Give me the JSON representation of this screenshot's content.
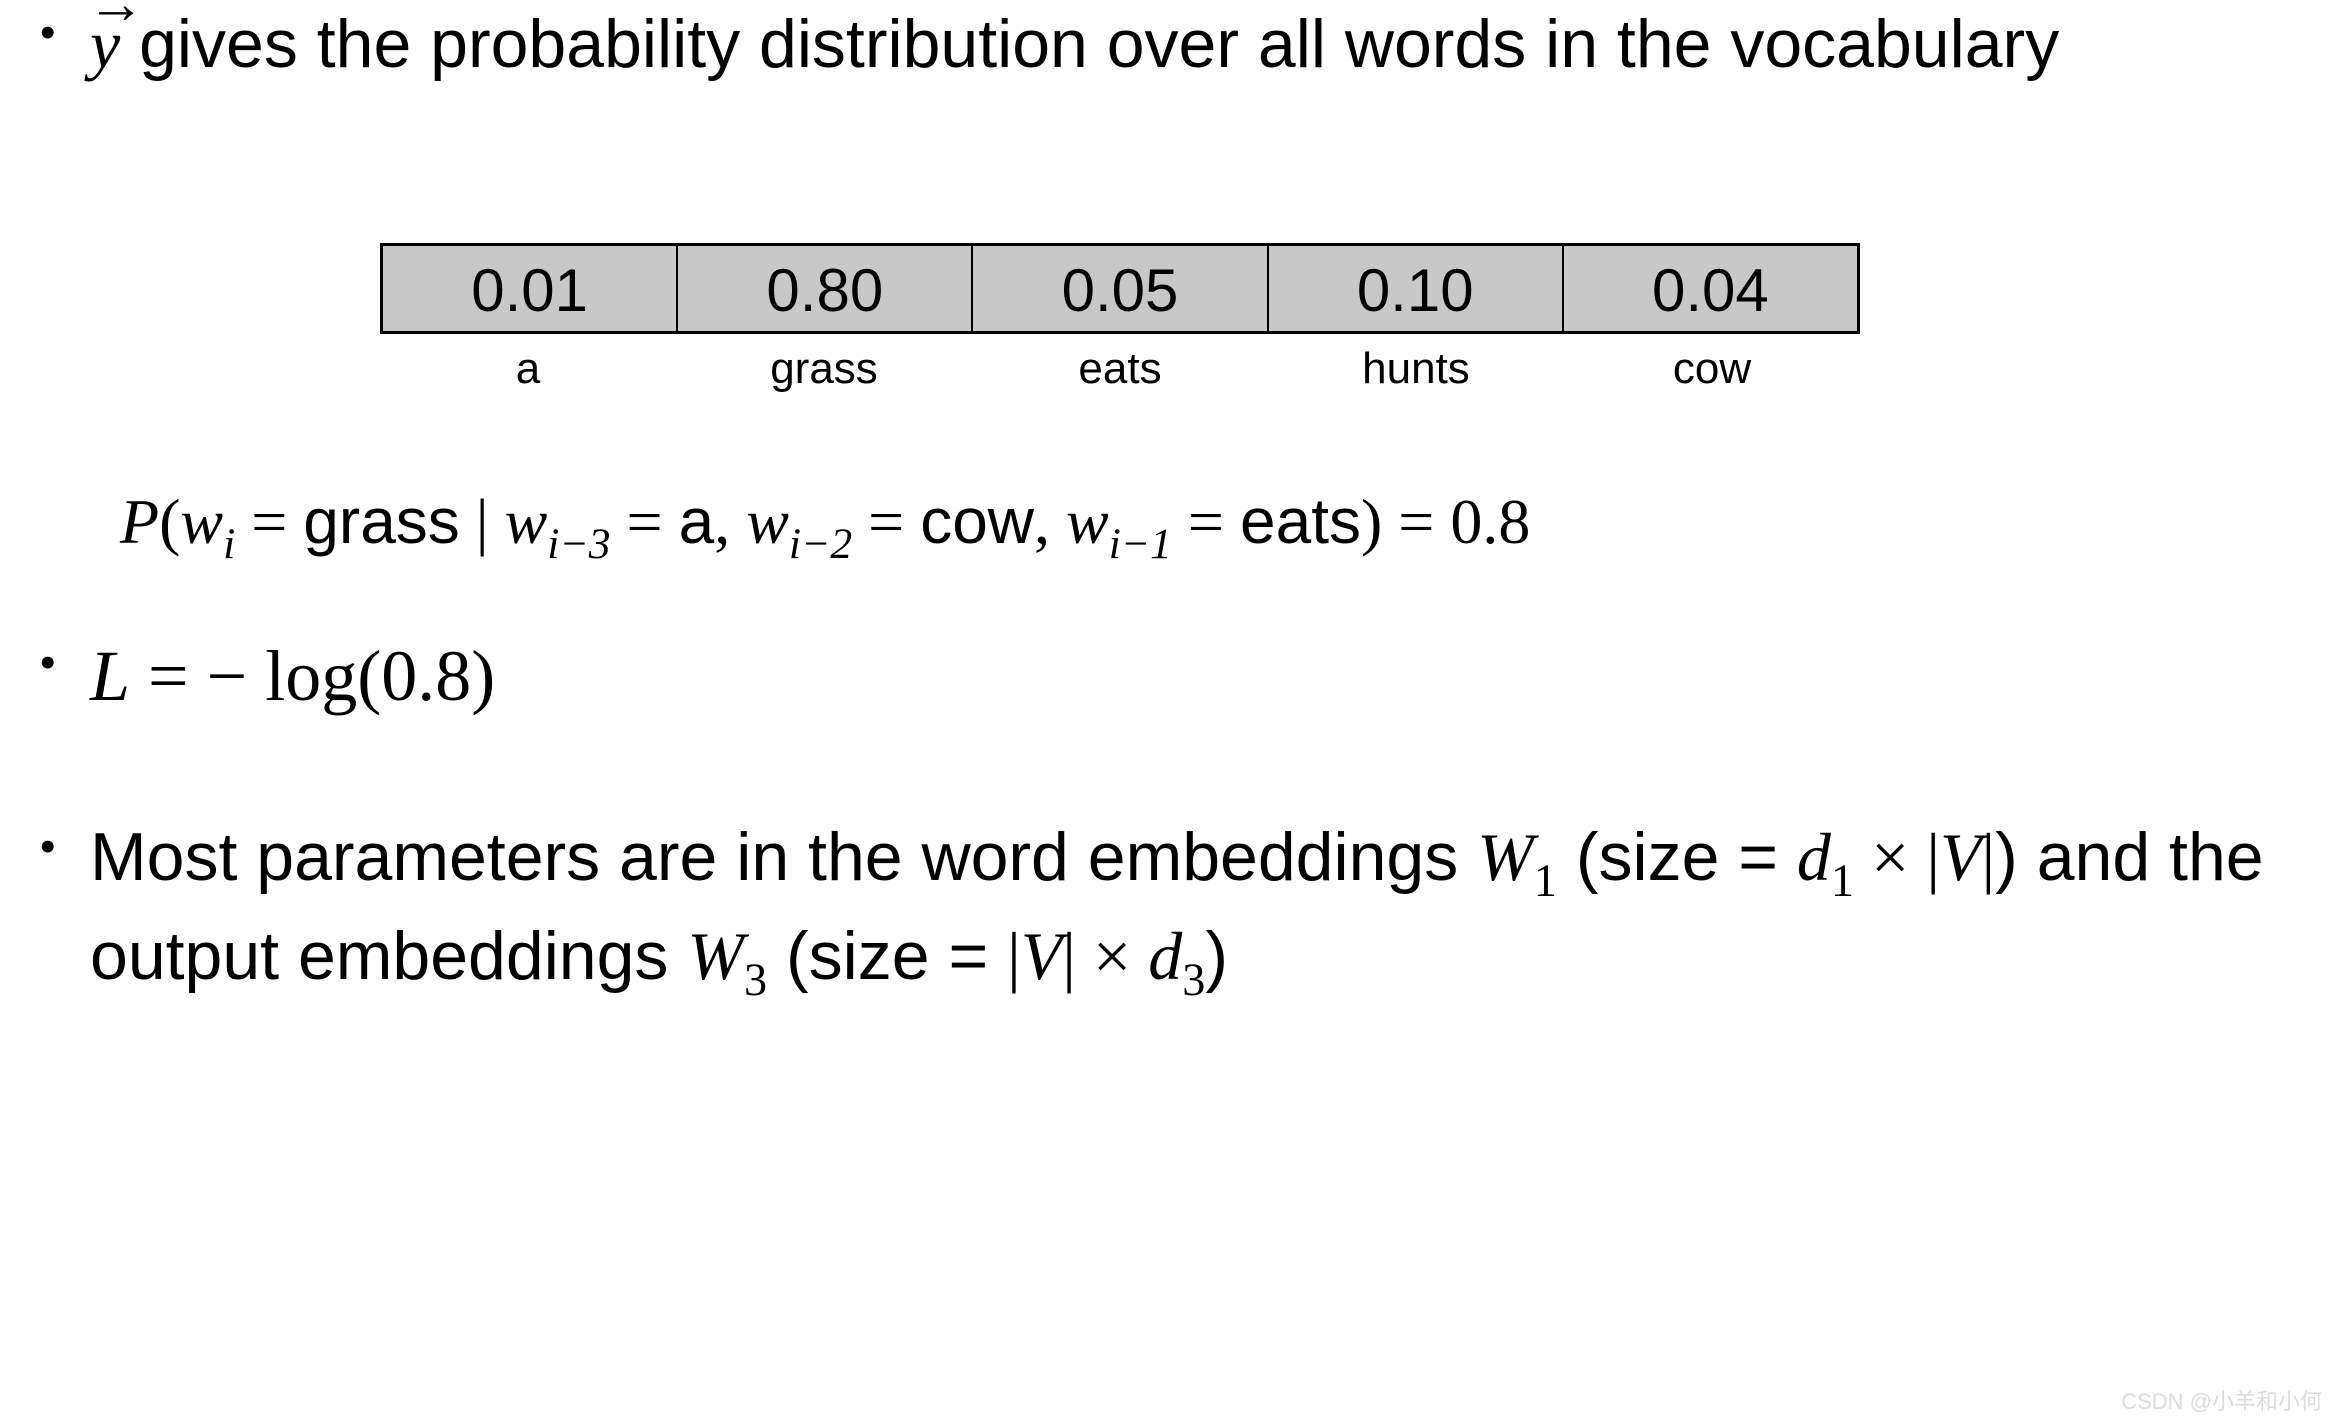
{
  "bullet1": {
    "y_symbol": "y",
    "text_after": " gives the probability distribution over all words in the vocabulary"
  },
  "distribution": {
    "values": [
      "0.01",
      "0.80",
      "0.05",
      "0.10",
      "0.04"
    ],
    "labels": [
      "a",
      "grass",
      "eats",
      "hunts",
      "cow"
    ]
  },
  "probability_line": {
    "P": "P",
    "open": "(",
    "w": "w",
    "i": "i",
    "eq": " = ",
    "grass": "grass",
    "bar": " | ",
    "wi3": "i−3",
    "a": "a",
    "comma": ", ",
    "wi2": "i−2",
    "cow": "cow",
    "wi1": "i−1",
    "eats": "eats",
    "close": ")",
    "eqval": " = 0.8"
  },
  "loss": {
    "L": "L",
    "rest": " = − log(0.8)"
  },
  "bullet3": {
    "t1": "Most parameters are in the word embeddings ",
    "W": "W",
    "one": "1",
    "t2": " (size = ",
    "d": "d",
    "times": " × ",
    "bar1": "|",
    "V": "V",
    "bar2": "|",
    "t3": ") and the output embeddings ",
    "three": "3",
    "t4": " (size = ",
    "d3sub": "3",
    "t5": ")"
  },
  "watermark": "CSDN @小羊和小何"
}
